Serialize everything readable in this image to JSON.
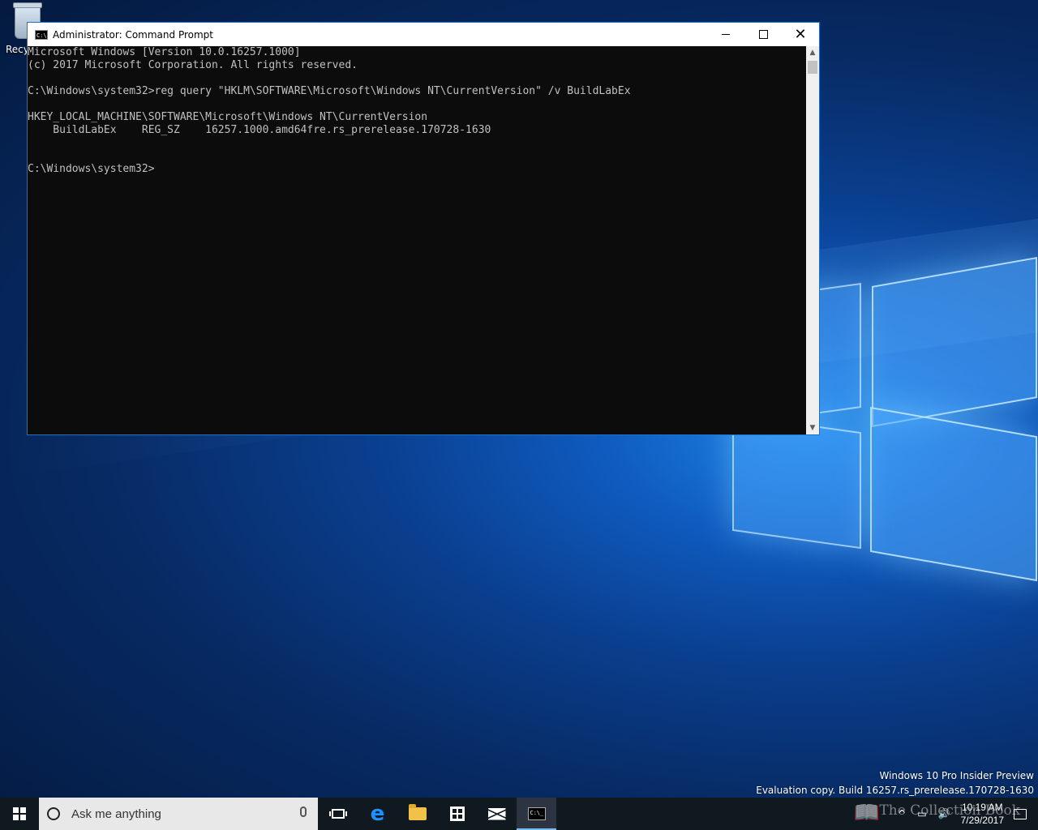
{
  "desktop": {
    "icons": [
      {
        "label": "Recy",
        "icon": "recycle-bin-icon"
      }
    ],
    "watermark": {
      "line1": "Windows 10 Pro Insider Preview",
      "line2": "Evaluation copy. Build 16257.rs_prerelease.170728-1630"
    }
  },
  "window": {
    "title": "Administrator: Command Prompt",
    "icon": "cmd-icon",
    "controls": {
      "minimize": "minimize-icon",
      "maximize": "maximize-icon",
      "close_glyph": "✕"
    },
    "console_lines": [
      "Microsoft Windows [Version 10.0.16257.1000]",
      "(c) 2017 Microsoft Corporation. All rights reserved.",
      "",
      "C:\\Windows\\system32>reg query \"HKLM\\SOFTWARE\\Microsoft\\Windows NT\\CurrentVersion\" /v BuildLabEx",
      "",
      "HKEY_LOCAL_MACHINE\\SOFTWARE\\Microsoft\\Windows NT\\CurrentVersion",
      "    BuildLabEx    REG_SZ    16257.1000.amd64fre.rs_prerelease.170728-1630",
      "",
      "",
      "C:\\Windows\\system32>"
    ],
    "scrollbar": {
      "up_glyph": "▲",
      "down_glyph": "▼"
    }
  },
  "taskbar": {
    "search": {
      "placeholder": "Ask me anything"
    },
    "apps": [
      {
        "name": "task-view",
        "icon": "task-view-icon"
      },
      {
        "name": "edge",
        "icon": "edge-icon",
        "glyph": "e"
      },
      {
        "name": "file-explorer",
        "icon": "folder-icon"
      },
      {
        "name": "store",
        "icon": "store-icon"
      },
      {
        "name": "mail",
        "icon": "mail-icon"
      },
      {
        "name": "command-prompt",
        "icon": "cmd-icon",
        "active": true
      }
    ],
    "tray": {
      "chevron": "^",
      "network": "network-icon",
      "volume_glyph": "🔊",
      "time": "10:19 AM",
      "date": "7/29/2017"
    },
    "overlay_text": "The Collection Book"
  },
  "colors": {
    "console_bg": "#0c0c0c",
    "console_fg": "#c0c0c0",
    "taskbar_bg": "#101820",
    "window_border": "#1e73c9",
    "active_indicator": "#76b9ed"
  }
}
